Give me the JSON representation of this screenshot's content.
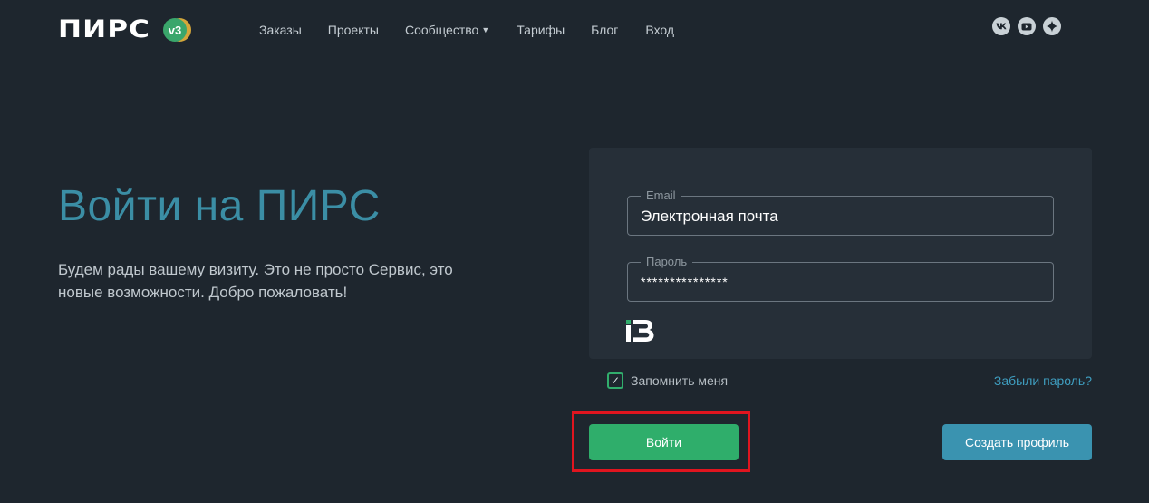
{
  "logo": {
    "text": "ПИРС",
    "badge": "v3"
  },
  "nav": {
    "items": [
      {
        "label": "Заказы"
      },
      {
        "label": "Проекты"
      },
      {
        "label": "Сообщество",
        "has_caret": true
      },
      {
        "label": "Тарифы"
      },
      {
        "label": "Блог"
      },
      {
        "label": "Вход"
      }
    ]
  },
  "social": [
    "vk-icon",
    "youtube-icon",
    "star-icon"
  ],
  "hero": {
    "title": "Войти на ПИРС",
    "text": "Будем рады вашему визиту. Это не просто Сервис, это новые возможности. Добро пожаловать!"
  },
  "form": {
    "email": {
      "legend": "Email",
      "placeholder": "Электронная почта",
      "value": ""
    },
    "password": {
      "legend": "Пароль",
      "value": "***************"
    },
    "remember_label": "Запомнить меня",
    "remember_checked": true,
    "forgot_label": "Забыли пароль?",
    "login_label": "Войти",
    "register_label": "Создать профиль"
  },
  "colors": {
    "background": "#1e262e",
    "panel": "#262f38",
    "title": "#3b8ea5",
    "login_button": "#2fae6b",
    "register_button": "#3a93b0",
    "highlight": "#e0151f"
  }
}
